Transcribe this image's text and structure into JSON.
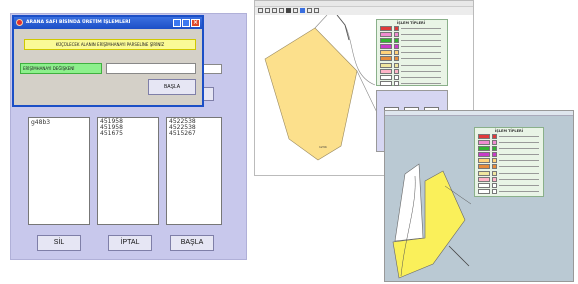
{
  "left_app": {
    "dialog": {
      "title": "ARANA SAFI BİSİNDA ÜRETİM İŞLEMLERİ",
      "info_text": "KÜÇÜLECEK ALANIN ERİŞİMHANAYI PARSELİNE ŞİRİNİZ",
      "field_label": "ERİŞİMHANAYI DEĞİŞKENİ",
      "field_value": "",
      "start_button": "BAŞLA"
    },
    "lists": [
      [
        "g48b3"
      ],
      [
        "451958",
        "451958",
        "451675"
      ],
      [
        "4522538",
        "4522538",
        "4515267"
      ]
    ],
    "buttons": {
      "delete": "SİL",
      "cancel": "İPTAL",
      "start": "BAŞLA"
    }
  },
  "map_app": {
    "colors": {
      "parcel": "#fce08c",
      "parcel_alt": "#faf05a",
      "water": "#bac9d3",
      "panel": "#d9d9f0"
    },
    "legend_title": "İŞLEM TİPLERİ",
    "legend_items": [
      {
        "color": "#e03a3a"
      },
      {
        "color": "#f08cd0"
      },
      {
        "color": "#32b432"
      },
      {
        "color": "#c83cc8"
      },
      {
        "color": "#ffd27a"
      },
      {
        "color": "#e68c3c"
      },
      {
        "color": "#f0e6a0"
      },
      {
        "color": "#ffb4c8"
      },
      {
        "color": "#ffffff"
      },
      {
        "color": "#ffffff"
      }
    ],
    "parcel_label": "1234"
  },
  "map_app_second": {
    "legend_title": "İŞLEM TİPLERİ",
    "legend_colors": [
      "#e03a3a",
      "#f08cd0",
      "#32b432",
      "#c83cc8",
      "#ffd27a",
      "#e68c3c",
      "#f0e6a0",
      "#ffb4c8",
      "#ffffff",
      "#ffffff"
    ]
  }
}
